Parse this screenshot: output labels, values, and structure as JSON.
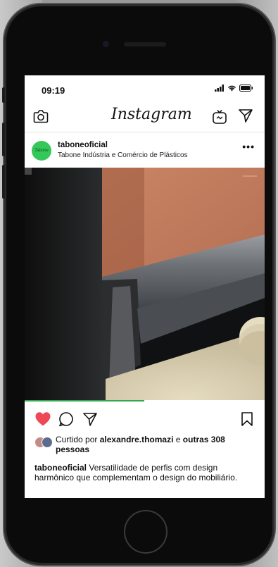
{
  "status_bar": {
    "time": "09:19"
  },
  "nav": {
    "logo": "Instagram"
  },
  "post": {
    "username": "taboneoficial",
    "location": "Tabone Indústria e Comércio de Plásticos",
    "avatar_text": "Tabone",
    "more": "•••",
    "likes": {
      "prefix": "Curtido por",
      "user": "alexandre.thomazi",
      "conj": "e",
      "others": "outras 308 pessoas"
    },
    "caption": {
      "user": "taboneoficial",
      "text": "Versatilidade de perfis com design harmônico que complementam o design do mobiliário."
    }
  },
  "colors": {
    "like": "#ed4956",
    "avatar": "#34c759",
    "progress": "#2fa84f"
  },
  "icons": [
    "camera-icon",
    "igtv-icon",
    "direct-message-icon",
    "heart-icon",
    "comment-icon",
    "share-icon",
    "bookmark-icon",
    "signal-icon",
    "wifi-icon",
    "battery-icon"
  ]
}
